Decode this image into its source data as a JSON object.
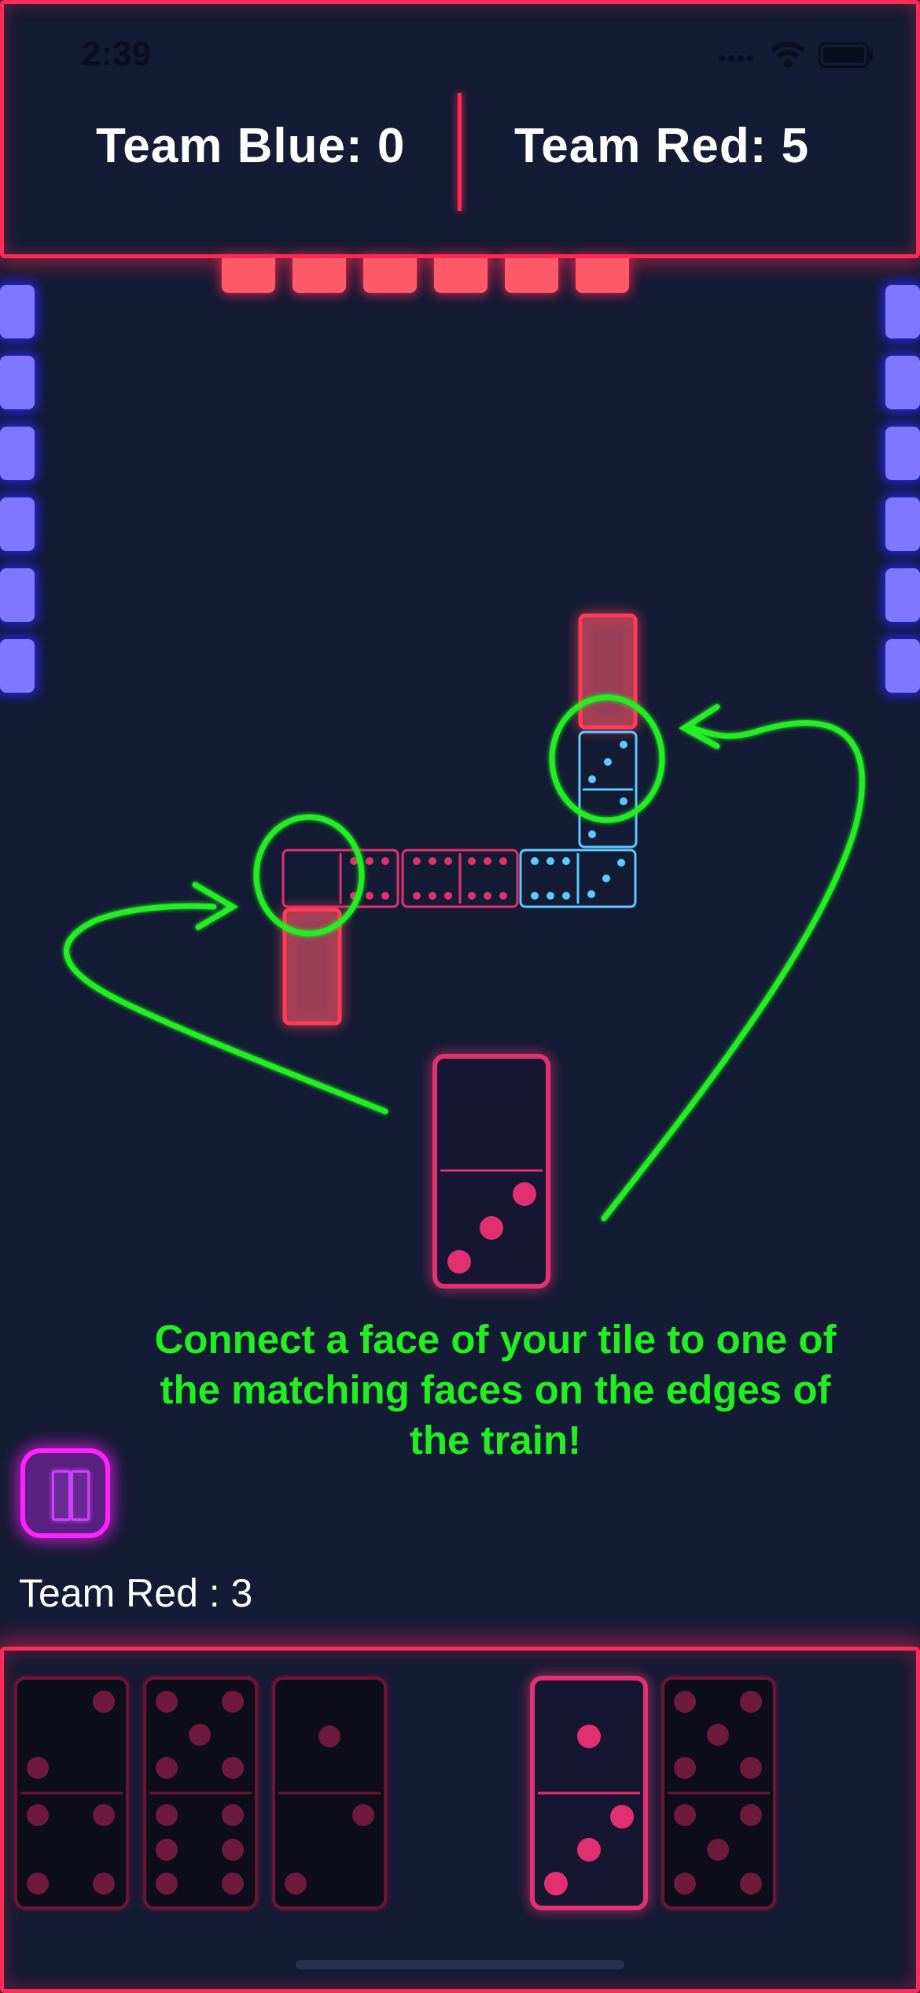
{
  "status_bar": {
    "time": "2:39"
  },
  "scoreboard": {
    "blue": "Team Blue: 0",
    "red": "Team Red: 5"
  },
  "hint": "Connect a face of your tile to one of the matching faces on the edges of the train!",
  "turn_label": "Team Red : 3",
  "colors": {
    "accent_red": "#ff2a55",
    "accent_blue": "#5ec8ff",
    "tile_pink": "#e0306f",
    "hint_green": "#22ee22",
    "pause_magenta": "#ff22ff",
    "background": "#141b34"
  },
  "icons": [
    "signal-icon",
    "wifi-icon",
    "battery-icon",
    "pause-icon"
  ],
  "opponent_top_tiles": 6,
  "opponent_left_tiles": 6,
  "opponent_right_tiles": 6,
  "board_train": [
    {
      "faces": [
        0,
        6
      ],
      "color": "red"
    },
    {
      "faces": [
        6,
        6
      ],
      "color": "red"
    },
    {
      "faces": [
        6,
        3
      ],
      "color": "blue"
    },
    {
      "faces": [
        3,
        2
      ],
      "color": "blue"
    }
  ],
  "dragged_tile": {
    "faces": [
      0,
      3
    ]
  },
  "hand": [
    {
      "faces": [
        2,
        4
      ],
      "selected": false
    },
    {
      "faces": [
        5,
        6
      ],
      "selected": false
    },
    {
      "faces": [
        1,
        2
      ],
      "selected": false
    },
    {
      "faces": [
        1,
        3
      ],
      "selected": true
    },
    {
      "faces": [
        5,
        5
      ],
      "selected": false
    }
  ]
}
